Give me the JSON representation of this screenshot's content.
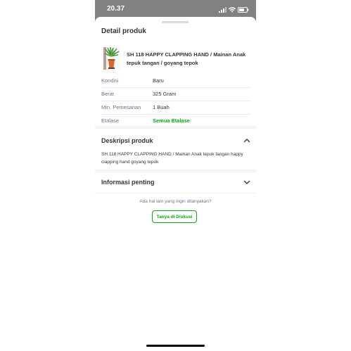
{
  "status_bar": {
    "time": "20.37"
  },
  "sheet": {
    "title": "Detail produk"
  },
  "product": {
    "name": "SH 118 HAPPY CLAPPING HAND / Mainan Anak tepuk tangan / goyang tepok",
    "thumbnail": "toy-plant-image"
  },
  "info_rows": [
    {
      "label": "Kondisi",
      "value": "Baru"
    },
    {
      "label": "Berat",
      "value": "325 Gram"
    },
    {
      "label": "Min. Pemesanan",
      "value": "1 Buah"
    },
    {
      "label": "Etalase",
      "value": "Semua Etalase"
    }
  ],
  "description": {
    "title": "Deskripsi produk",
    "text": "SH 118 HAPPY CLAPPING HAND / Mainan Anak tepuk tangan happy clapping hand goyang tepok",
    "icon": "chevron-up-icon"
  },
  "important_info": {
    "title": "Informasi penting",
    "icon": "chevron-down-icon"
  },
  "ask": {
    "prompt": "Ada hal lain yang ingin ditanyakan?",
    "button_label": "Tanya di Diskusi"
  },
  "colors": {
    "accent": "#03ac0e",
    "status_bar": "#818181",
    "text": "#31353b",
    "muted": "#6d7588"
  }
}
